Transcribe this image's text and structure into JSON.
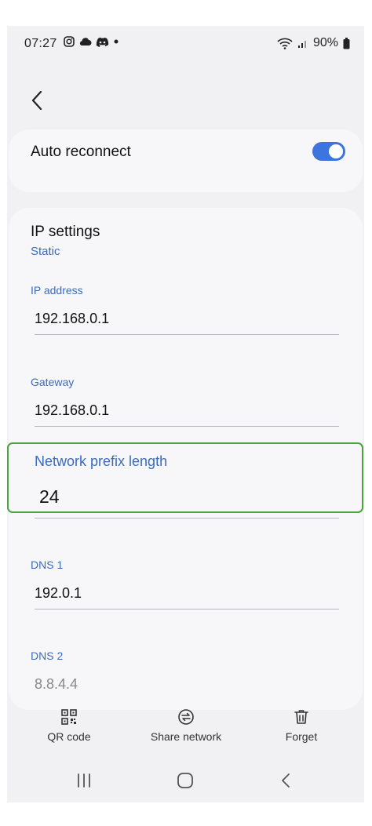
{
  "status_bar": {
    "time": "07:27",
    "battery": "90%",
    "icons": [
      "instagram-icon",
      "cloud-icon",
      "discord-icon",
      "dot-icon",
      "wifi-icon",
      "signal-icon",
      "battery-icon"
    ]
  },
  "auto_reconnect": {
    "label": "Auto reconnect",
    "enabled": true,
    "accent": "#3d74e0"
  },
  "ip_settings": {
    "title": "IP settings",
    "mode": "Static",
    "fields": {
      "ip_address": {
        "label": "IP address",
        "value": "192.168.0.1"
      },
      "gateway": {
        "label": "Gateway",
        "value": "192.168.0.1"
      },
      "prefix": {
        "label": "Network prefix length",
        "value": "24"
      },
      "dns1": {
        "label": "DNS 1",
        "value": "192.0.1"
      },
      "dns2": {
        "label": "DNS 2",
        "value": "8.8.4.4"
      }
    }
  },
  "actions": {
    "qr": "QR code",
    "share": "Share network",
    "forget": "Forget"
  },
  "colors": {
    "highlight": "#49a43c",
    "link": "#3b6bbf"
  }
}
